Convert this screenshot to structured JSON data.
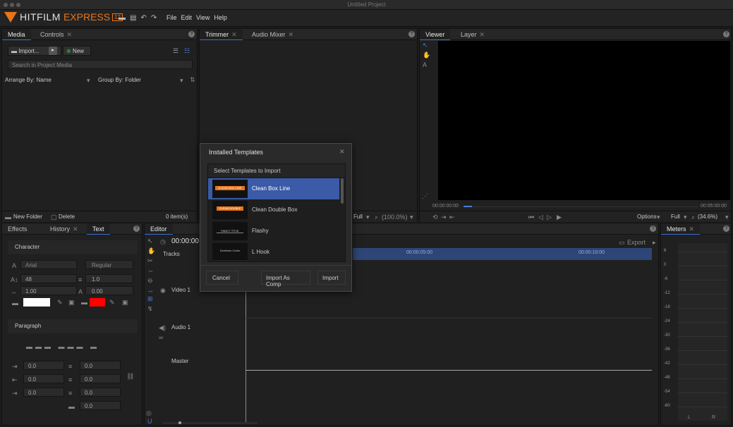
{
  "window": {
    "title": "Untitled Project"
  },
  "app": {
    "logo_main": "HITFILM",
    "logo_sub": "EXPRESS",
    "logo_badge": "12"
  },
  "menus": [
    "File",
    "Edit",
    "View",
    "Help"
  ],
  "media_panel": {
    "tabs": [
      "Media",
      "Controls"
    ],
    "import_label": "Import...",
    "new_label": "New",
    "search_placeholder": "Search in Project Media",
    "arrange_label": "Arrange By: Name",
    "group_label": "Group By: Folder",
    "new_folder_label": "New Folder",
    "delete_label": "Delete",
    "item_count": "0 item(s)"
  },
  "trimmer_panel": {
    "tabs": [
      "Trimmer",
      "Audio Mixer"
    ],
    "zoom_full": "Full",
    "zoom_pct": "(100.0%)"
  },
  "viewer_panel": {
    "tabs": [
      "Viewer",
      "Layer"
    ],
    "time_start": "00:00:00:00",
    "time_end": "00:05:00:00",
    "options_label": "Options",
    "zoom_full": "Full",
    "zoom_pct": "(34.6%)"
  },
  "text_panel": {
    "tabs": [
      "Effects",
      "History",
      "Text"
    ],
    "character_label": "Character",
    "font_name": "Arial",
    "font_style": "Regular",
    "font_size": "48",
    "leading": "1.0",
    "scale": "1.00",
    "tracking": "0.00",
    "paragraph_label": "Paragraph",
    "indent_values": [
      "0.0",
      "0.0",
      "0.0",
      "0.0",
      "0.0",
      "0.0",
      "0.0"
    ],
    "fill_color": "#ffffff",
    "stroke_color": "#ff0000"
  },
  "editor_panel": {
    "tab": "Editor",
    "timecode": "00:00:00",
    "tracks_label": "Tracks",
    "export_label": "Export",
    "ruler_marks": [
      "00:00:05:00",
      "00:00:10:00"
    ],
    "tracks": [
      "Video 1",
      "Audio 1",
      "Master"
    ]
  },
  "meters_panel": {
    "tab": "Meters",
    "scale": [
      "6",
      "0",
      "-6",
      "-12",
      "-18",
      "-24",
      "-30",
      "-36",
      "-42",
      "-48",
      "-54",
      "-60"
    ],
    "channels": [
      "L",
      "R"
    ]
  },
  "dialog": {
    "title": "Installed Templates",
    "subtitle": "Select Templates to Import",
    "items": [
      {
        "name": "Clean Box Line",
        "thumb_text": "CLEAN BOX LINE"
      },
      {
        "name": "Clean Double Box",
        "thumb_text": "CLEAN DOUBLE BOX"
      },
      {
        "name": "Flashy",
        "thumb_text": "FANCY TITLE"
      },
      {
        "name": "L Hook",
        "thumb_text": "Dominick Corbo"
      }
    ],
    "cancel_label": "Cancel",
    "import_comp_label": "Import As Comp",
    "import_label": "Import"
  },
  "colors": {
    "accent": "#e8751a",
    "selection": "#3b5ba8",
    "highlight_blue": "#4a7fd6"
  }
}
